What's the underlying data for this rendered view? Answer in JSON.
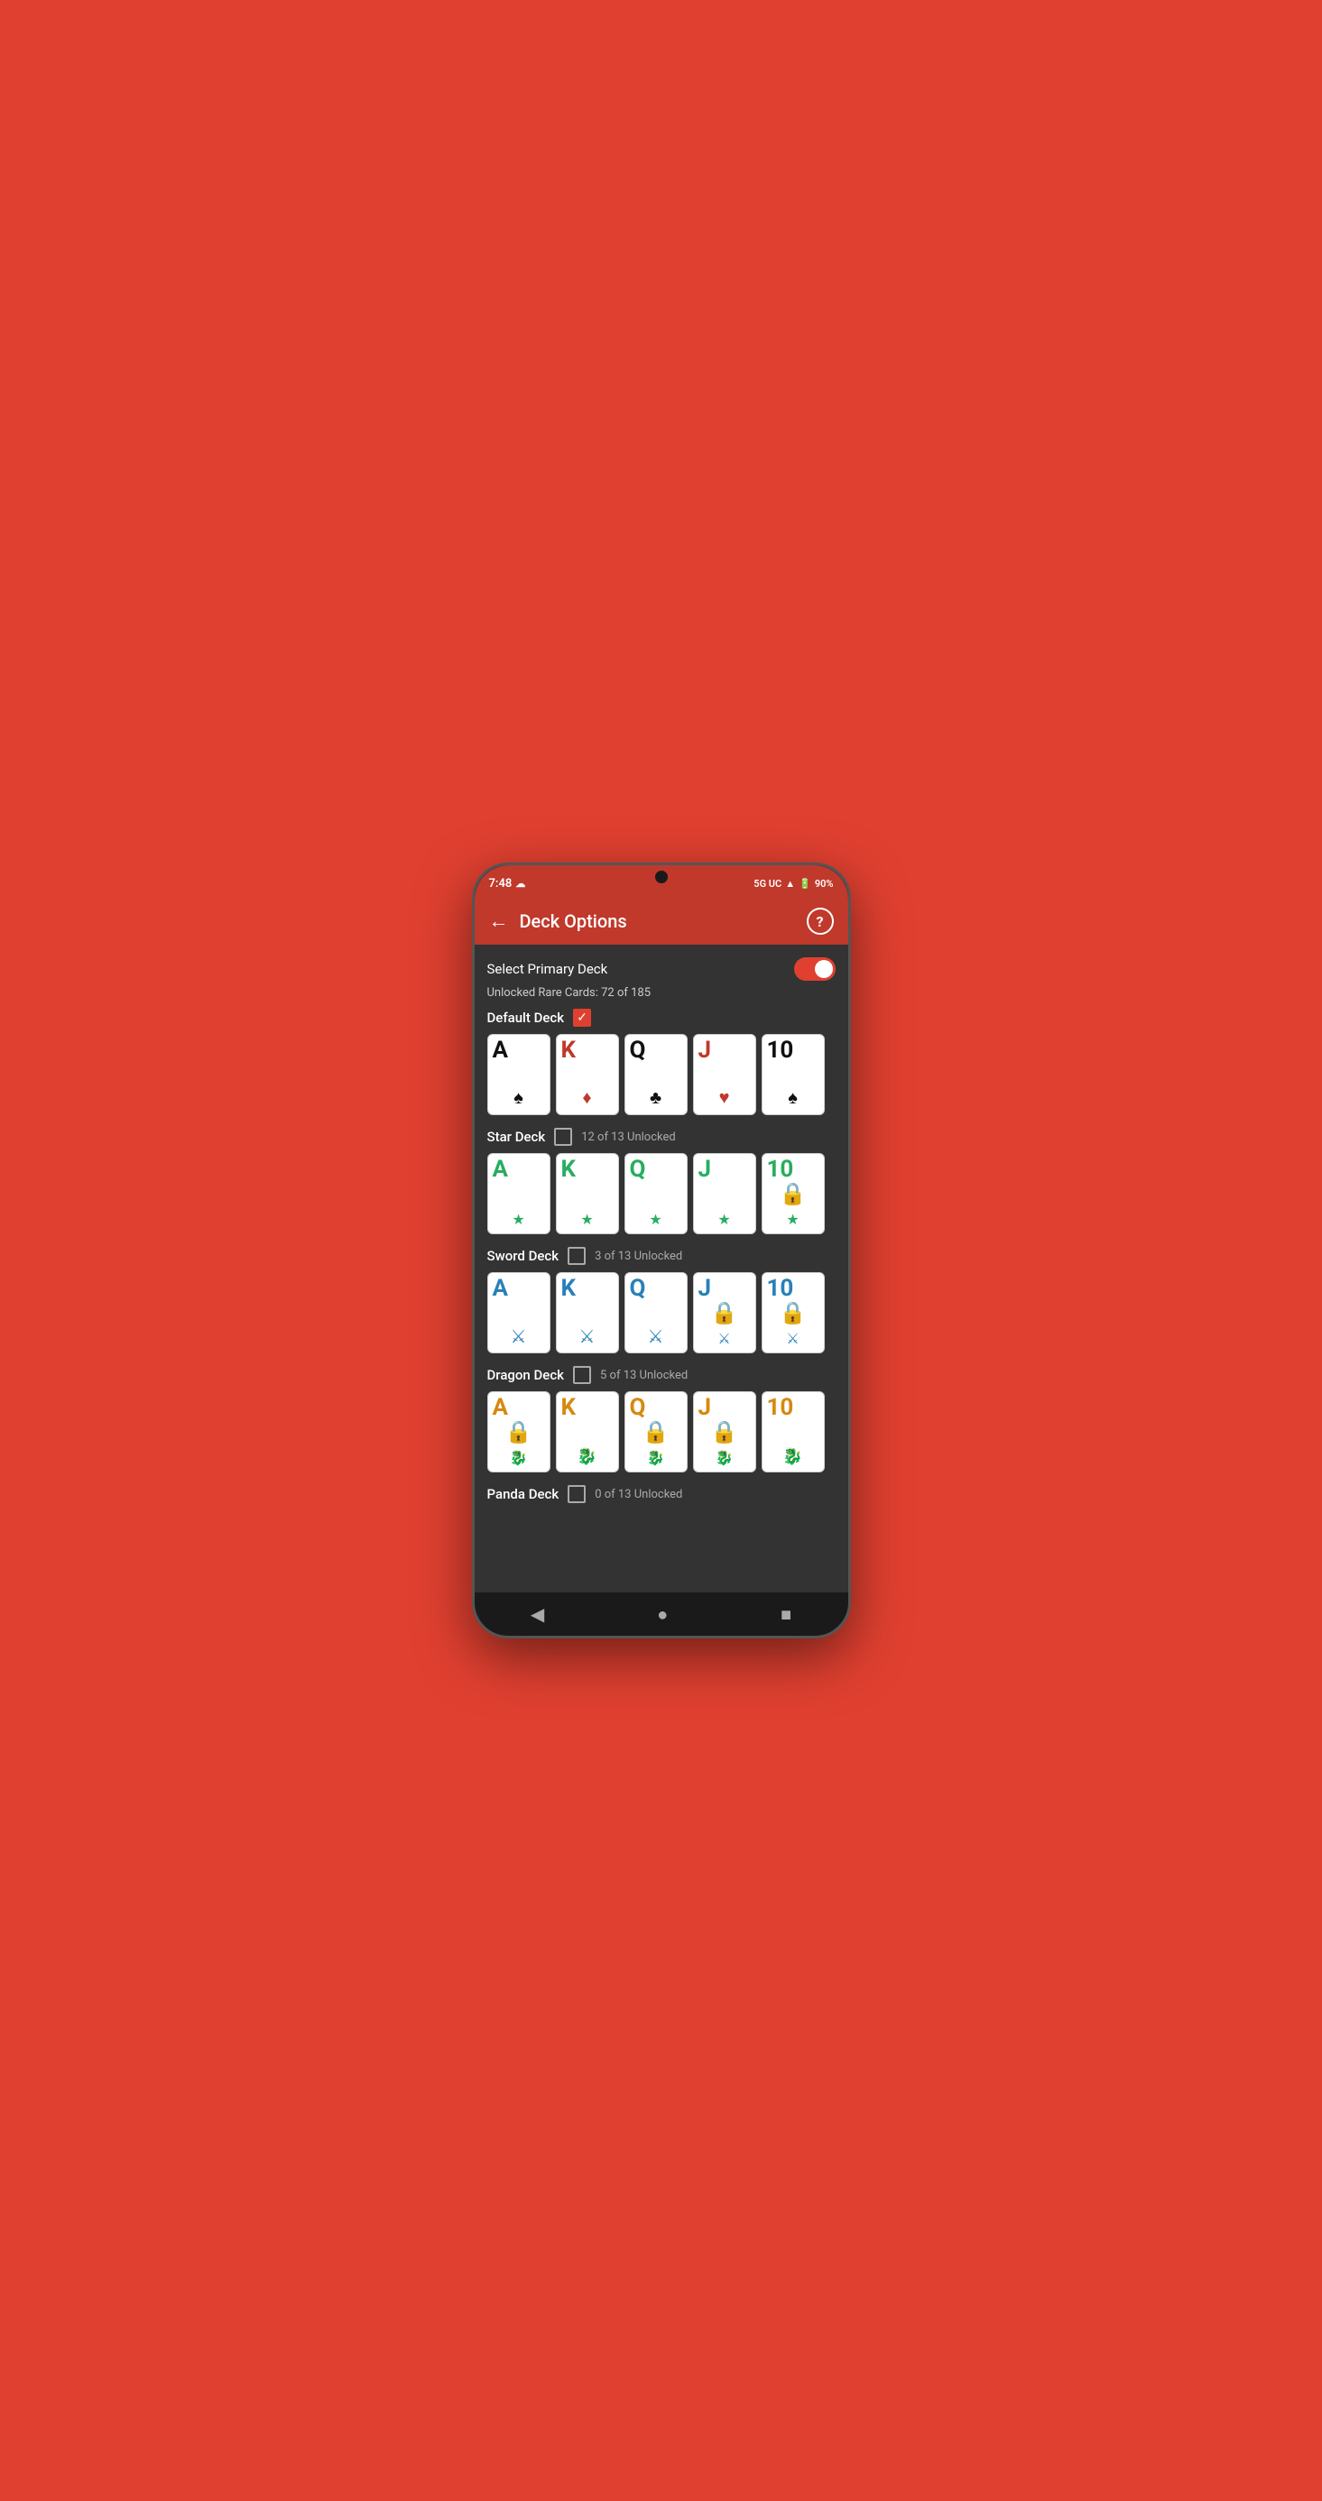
{
  "status_bar": {
    "time": "7:48",
    "network": "5G UC",
    "battery": "90%"
  },
  "app_bar": {
    "back_label": "←",
    "title": "Deck Options",
    "help_label": "?"
  },
  "primary_deck": {
    "label": "Select Primary Deck",
    "toggle_on": true
  },
  "unlocked_rare": {
    "text": "Unlocked Rare Cards: 72 of 185"
  },
  "decks": [
    {
      "name": "Default Deck",
      "checked": true,
      "unlock_text": "",
      "cards": [
        {
          "letter": "A",
          "color": "black",
          "suit": "♠",
          "suit_color": "black",
          "locked": false
        },
        {
          "letter": "K",
          "color": "red",
          "suit": "♦",
          "suit_color": "red",
          "locked": false
        },
        {
          "letter": "Q",
          "color": "black",
          "suit": "♣",
          "suit_color": "black",
          "locked": false
        },
        {
          "letter": "J",
          "color": "red",
          "suit": "♥",
          "suit_color": "red",
          "locked": false
        },
        {
          "letter": "10",
          "color": "black",
          "suit": "♠",
          "suit_color": "black",
          "locked": false
        }
      ]
    },
    {
      "name": "Star Deck",
      "checked": false,
      "unlock_text": "12 of 13 Unlocked",
      "cards": [
        {
          "letter": "A",
          "color": "green",
          "suit": "★",
          "suit_color": "green",
          "locked": false
        },
        {
          "letter": "K",
          "color": "green",
          "suit": "★",
          "suit_color": "green",
          "locked": false
        },
        {
          "letter": "Q",
          "color": "green",
          "suit": "★",
          "suit_color": "green",
          "locked": false
        },
        {
          "letter": "J",
          "color": "green",
          "suit": "★",
          "suit_color": "green",
          "locked": false
        },
        {
          "letter": "10",
          "color": "green",
          "suit": "★",
          "suit_color": "green",
          "locked": true
        }
      ]
    },
    {
      "name": "Sword Deck",
      "checked": false,
      "unlock_text": "3 of 13 Unlocked",
      "cards": [
        {
          "letter": "A",
          "color": "blue",
          "suit": "🗡",
          "suit_color": "blue",
          "locked": false
        },
        {
          "letter": "K",
          "color": "blue",
          "suit": "🗡",
          "suit_color": "blue",
          "locked": false
        },
        {
          "letter": "Q",
          "color": "blue",
          "suit": "🗡",
          "suit_color": "blue",
          "locked": false
        },
        {
          "letter": "J",
          "color": "blue",
          "suit": "🗡",
          "suit_color": "blue",
          "locked": true
        },
        {
          "letter": "10",
          "color": "blue",
          "suit": "🗡",
          "suit_color": "blue",
          "locked": true
        }
      ]
    },
    {
      "name": "Dragon Deck",
      "checked": false,
      "unlock_text": "5 of 13 Unlocked",
      "cards": [
        {
          "letter": "A",
          "color": "orange",
          "suit": "🐉",
          "suit_color": "orange",
          "locked": true
        },
        {
          "letter": "K",
          "color": "orange",
          "suit": "🐉",
          "suit_color": "orange",
          "locked": false
        },
        {
          "letter": "Q",
          "color": "orange",
          "suit": "🐉",
          "suit_color": "orange",
          "locked": true
        },
        {
          "letter": "J",
          "color": "orange",
          "suit": "🐉",
          "suit_color": "orange",
          "locked": true
        },
        {
          "letter": "10",
          "color": "orange",
          "suit": "🐉",
          "suit_color": "orange",
          "locked": false
        }
      ]
    },
    {
      "name": "Panda Deck",
      "checked": false,
      "unlock_text": "0 of 13 Unlocked",
      "cards": []
    }
  ],
  "nav": {
    "back": "◀",
    "home": "●",
    "recent": "■"
  }
}
